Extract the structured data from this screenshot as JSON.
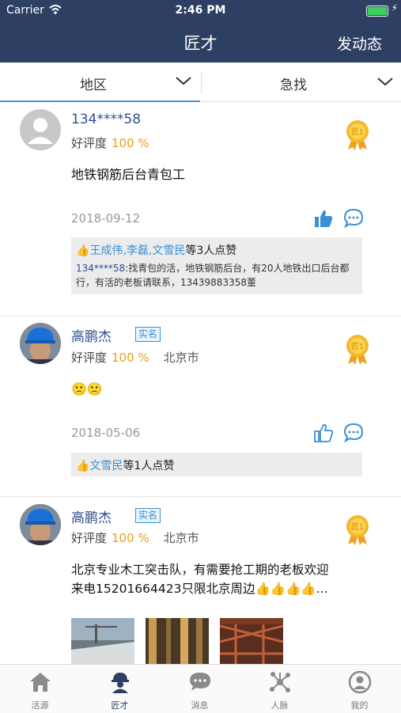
{
  "status_bar": {
    "carrier": "Carrier",
    "time": "2:46 PM"
  },
  "nav": {
    "title": "匠才",
    "action": "发动态"
  },
  "filters": [
    {
      "label": "地区"
    },
    {
      "label": "急找"
    }
  ],
  "posts": [
    {
      "name": "134****58",
      "verified": "",
      "rating_label": "好评度",
      "rating_value": "100 %",
      "city": "",
      "content": "地铁钢筋后台青包工",
      "date": "2018-09-12",
      "liked": true,
      "likes_names": "王成伟,李磊,文雪民",
      "likes_suffix": "等3人点赞",
      "reply_user": "134****58",
      "reply_text": ":找青包的活，地铁钢筋后台，有20人地铁出口后台都行，有活的老板请联系，13439883358董"
    },
    {
      "name": "高鹏杰",
      "verified": "实名",
      "rating_label": "好评度",
      "rating_value": "100 %",
      "city": "北京市",
      "content": "🙁🙁",
      "date": "2018-05-06",
      "liked": false,
      "likes_names": "文雪民",
      "likes_suffix": "等1人点赞"
    },
    {
      "name": "高鹏杰",
      "verified": "实名",
      "rating_label": "好评度",
      "rating_value": "100 %",
      "city": "北京市",
      "content_line1": "北京专业木工突击队，有需要抢工期的老板欢迎",
      "content_line2": "来电15201664423只限北京周边👍👍👍👍..."
    }
  ],
  "tabs": [
    {
      "label": "活源",
      "icon": "home-icon"
    },
    {
      "label": "匠才",
      "icon": "worker-icon"
    },
    {
      "label": "消息",
      "icon": "chat-icon"
    },
    {
      "label": "人脉",
      "icon": "network-icon"
    },
    {
      "label": "我的",
      "icon": "profile-icon"
    }
  ],
  "colors": {
    "nav_bg": "#2d3f63",
    "accent": "#3a8fd6",
    "rating": "#f39c12",
    "medal": "#f5b82e"
  }
}
